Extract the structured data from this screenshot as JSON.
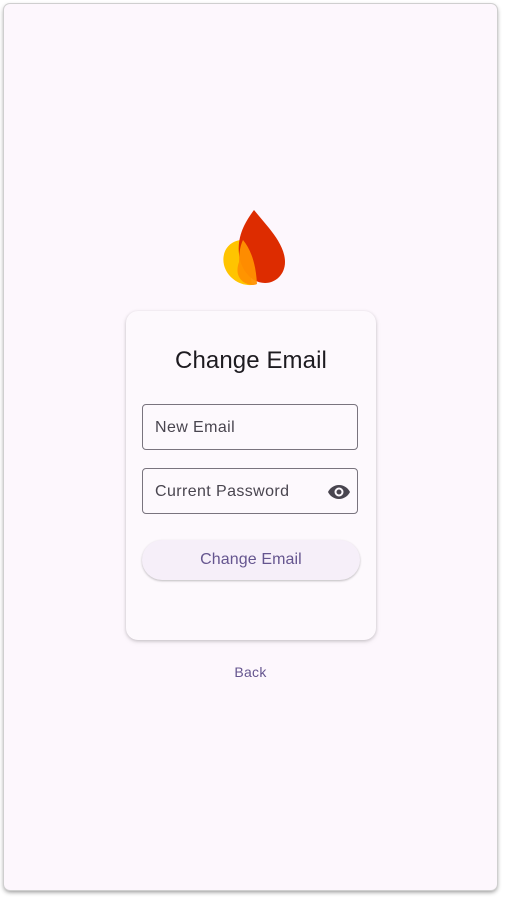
{
  "logo": {
    "icon": "flame-logo-icon",
    "colors": [
      "#ffc400",
      "#dd2c00",
      "#ff9100"
    ]
  },
  "card": {
    "title": "Change Email",
    "email_field": {
      "placeholder": "New Email",
      "value": ""
    },
    "password_field": {
      "placeholder": "Current Password",
      "value": "",
      "toggle_icon": "eye-icon"
    },
    "submit_label": "Change Email"
  },
  "back_label": "Back",
  "colors": {
    "background": "#fdf7fd",
    "primary": "#65558f",
    "outline": "#79747e",
    "button_fill": "#f6eff9",
    "text": "#1d1b20"
  }
}
